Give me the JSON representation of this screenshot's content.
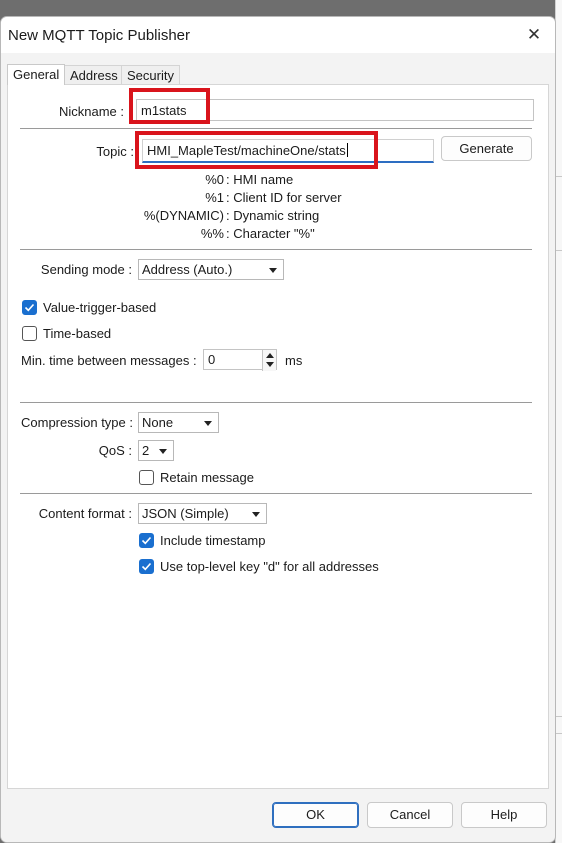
{
  "window": {
    "title": "New MQTT Topic Publisher"
  },
  "tabs": [
    {
      "label": "General",
      "active": true
    },
    {
      "label": "Address",
      "active": false
    },
    {
      "label": "Security",
      "active": false
    }
  ],
  "general": {
    "nickname_label": "Nickname :",
    "nickname_value": "m1stats",
    "topic_label": "Topic :",
    "topic_value": "HMI_MapleTest/machineOne/stats",
    "generate_label": "Generate",
    "placeholders": [
      {
        "code": "%0",
        "desc": ": HMI name"
      },
      {
        "code": "%1",
        "desc": ": Client ID for server"
      },
      {
        "code": "%(DYNAMIC)",
        "desc": ": Dynamic string"
      },
      {
        "code": "%%",
        "desc": ": Character \"%\""
      }
    ],
    "sending_mode_label": "Sending mode :",
    "sending_mode_value": "Address (Auto.)",
    "value_trigger_label": "Value-trigger-based",
    "value_trigger_checked": true,
    "time_based_label": "Time-based",
    "time_based_checked": false,
    "min_time_label": "Min. time between messages :",
    "min_time_value": "0",
    "min_time_unit": "ms",
    "compression_label": "Compression type :",
    "compression_value": "None",
    "qos_label": "QoS :",
    "qos_value": "2",
    "retain_label": "Retain message",
    "retain_checked": false,
    "content_format_label": "Content format :",
    "content_format_value": "JSON (Simple)",
    "include_timestamp_label": "Include timestamp",
    "include_timestamp_checked": true,
    "top_level_key_label": "Use top-level key \"d\" for all addresses",
    "top_level_key_checked": true
  },
  "footer": {
    "ok_label": "OK",
    "cancel_label": "Cancel",
    "help_label": "Help"
  },
  "annotation_color": "#d9141c",
  "accent_color": "#1a6fcf"
}
